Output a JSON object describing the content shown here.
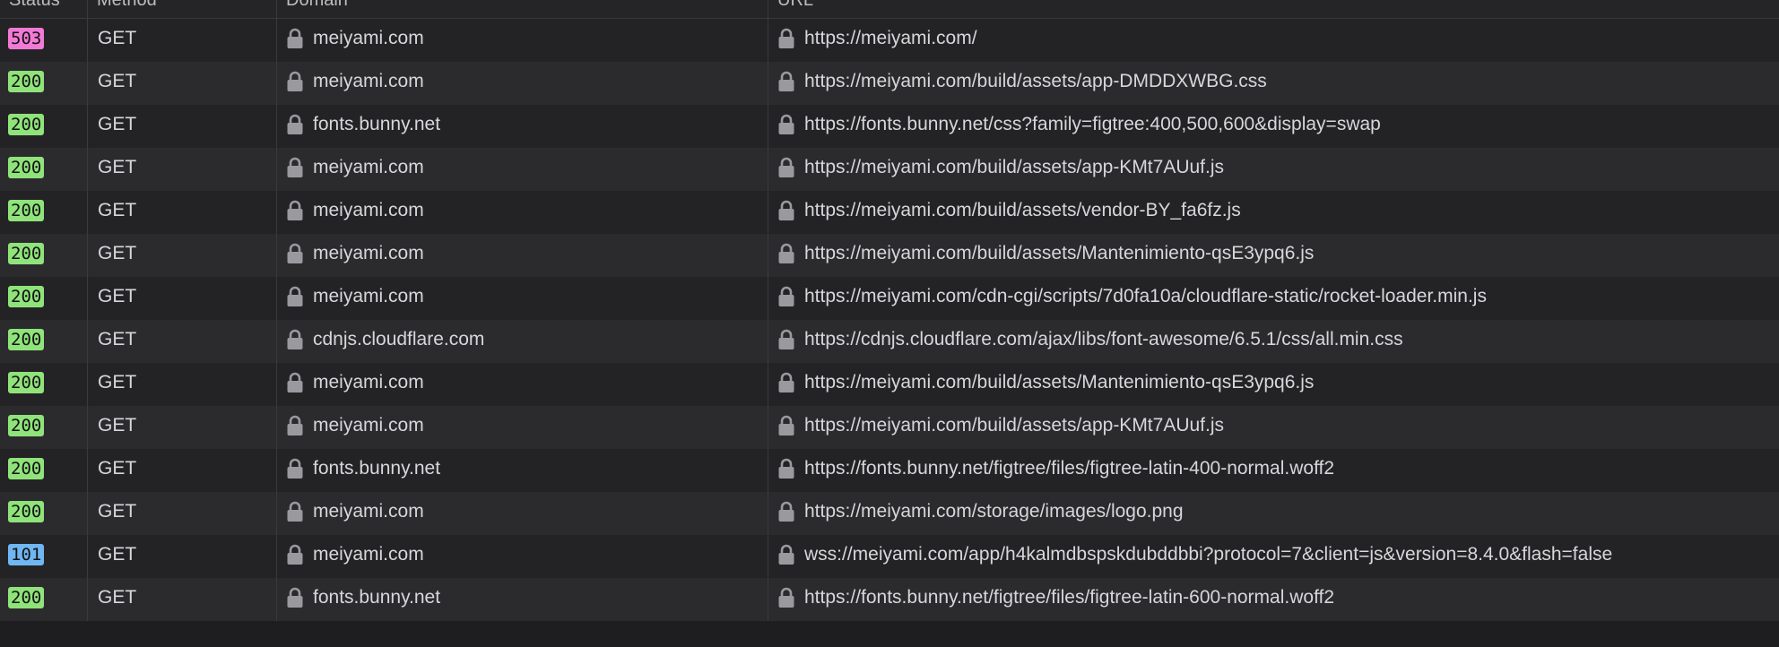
{
  "columns": {
    "status": "Status",
    "method": "Method",
    "domain": "Domain",
    "url": "URL"
  },
  "colors": {
    "status_2xx": "#8fe37a",
    "status_5xx": "#f27ad7",
    "status_1xx": "#6fb6f2",
    "lock": "#9a9a9e"
  },
  "rows": [
    {
      "status": "503",
      "method": "GET",
      "domain": "meiyami.com",
      "url": "https://meiyami.com/"
    },
    {
      "status": "200",
      "method": "GET",
      "domain": "meiyami.com",
      "url": "https://meiyami.com/build/assets/app-DMDDXWBG.css"
    },
    {
      "status": "200",
      "method": "GET",
      "domain": "fonts.bunny.net",
      "url": "https://fonts.bunny.net/css?family=figtree:400,500,600&display=swap"
    },
    {
      "status": "200",
      "method": "GET",
      "domain": "meiyami.com",
      "url": "https://meiyami.com/build/assets/app-KMt7AUuf.js"
    },
    {
      "status": "200",
      "method": "GET",
      "domain": "meiyami.com",
      "url": "https://meiyami.com/build/assets/vendor-BY_fa6fz.js"
    },
    {
      "status": "200",
      "method": "GET",
      "domain": "meiyami.com",
      "url": "https://meiyami.com/build/assets/Mantenimiento-qsE3ypq6.js"
    },
    {
      "status": "200",
      "method": "GET",
      "domain": "meiyami.com",
      "url": "https://meiyami.com/cdn-cgi/scripts/7d0fa10a/cloudflare-static/rocket-loader.min.js"
    },
    {
      "status": "200",
      "method": "GET",
      "domain": "cdnjs.cloudflare.com",
      "url": "https://cdnjs.cloudflare.com/ajax/libs/font-awesome/6.5.1/css/all.min.css"
    },
    {
      "status": "200",
      "method": "GET",
      "domain": "meiyami.com",
      "url": "https://meiyami.com/build/assets/Mantenimiento-qsE3ypq6.js"
    },
    {
      "status": "200",
      "method": "GET",
      "domain": "meiyami.com",
      "url": "https://meiyami.com/build/assets/app-KMt7AUuf.js"
    },
    {
      "status": "200",
      "method": "GET",
      "domain": "fonts.bunny.net",
      "url": "https://fonts.bunny.net/figtree/files/figtree-latin-400-normal.woff2"
    },
    {
      "status": "200",
      "method": "GET",
      "domain": "meiyami.com",
      "url": "https://meiyami.com/storage/images/logo.png"
    },
    {
      "status": "101",
      "method": "GET",
      "domain": "meiyami.com",
      "url": "wss://meiyami.com/app/h4kalmdbspskdubddbbi?protocol=7&client=js&version=8.4.0&flash=false"
    },
    {
      "status": "200",
      "method": "GET",
      "domain": "fonts.bunny.net",
      "url": "https://fonts.bunny.net/figtree/files/figtree-latin-600-normal.woff2"
    }
  ]
}
